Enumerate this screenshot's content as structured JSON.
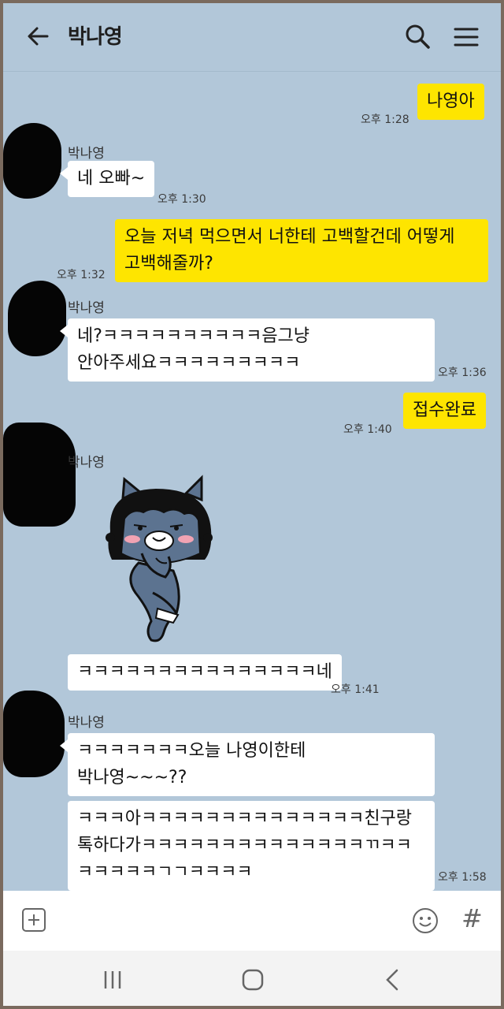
{
  "header": {
    "title": "박나영",
    "back_icon": "arrow-left-icon",
    "search_icon": "search-icon",
    "menu_icon": "hamburger-menu-icon"
  },
  "messages": [
    {
      "type": "out",
      "text": "나영아",
      "time": "오후 1:28"
    },
    {
      "type": "in",
      "sender": "박나영",
      "text": "네 오빠~",
      "time": "오후 1:30"
    },
    {
      "type": "out",
      "text": "오늘 저녁 먹으면서 너한테 고백할건데 어떻게\n고백해줄까?",
      "time": "오후 1:32"
    },
    {
      "type": "in",
      "sender": "박나영",
      "text": "네?ㅋㅋㅋㅋㅋㅋㅋㅋㅋㅋ음그냥\n안아주세요ㅋㅋㅋㅋㅋㅋㅋㅋㅋ",
      "time": "오후 1:36"
    },
    {
      "type": "out",
      "text": "접수완료",
      "time": "오후 1:40"
    },
    {
      "type": "in",
      "sender": "박나영",
      "sticker": "blushing-cat-character-sticker"
    },
    {
      "type": "in",
      "text": "ㅋㅋㅋㅋㅋㅋㅋㅋㅋㅋㅋㅋㅋㅋㅋ네",
      "time": "오후 1:41"
    },
    {
      "type": "in",
      "sender": "박나영",
      "text": "ㅋㅋㅋㅋㅋㅋㅋ오늘 나영이한테\n박나영~~~??"
    },
    {
      "type": "in",
      "text": "ㅋㅋㅋ아ㅋㅋㅋㅋㅋㅋㅋㅋㅋㅋㅋㅋㅋㅋ친구랑\n톡하다가ㅋㅋㅋㅋㅋㅋㅋㅋㅋㅋㅋㅋㅋㅋㄲㅋㅋ\nㅋㅋㅋㅋㅋㄱㄱㅋㅋㅋㅋ",
      "time": "오후 1:58"
    }
  ],
  "input_bar": {
    "plus_icon": "plus-square-icon",
    "emoji_icon": "emoji-smile-icon",
    "hash_icon": "hash-icon",
    "hash_glyph": "#"
  },
  "nav_bar": {
    "recents_icon": "recent-apps-icon",
    "home_icon": "home-icon",
    "back_icon": "back-chevron-icon"
  },
  "colors": {
    "chat_bg": "#b2c7d9",
    "out_bubble": "#fee500",
    "in_bubble": "#ffffff"
  }
}
